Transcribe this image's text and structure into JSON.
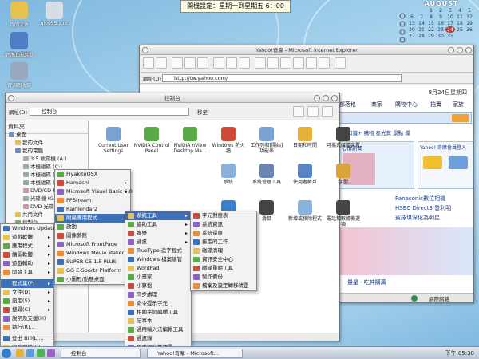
{
  "desktop": {
    "icons": [
      {
        "label": "我的文件",
        "color": "#e8c04f"
      },
      {
        "label": "ql0995.jr.rit",
        "color": "#d7dde7"
      },
      {
        "label": "我的電腦",
        "color": "#6d8fc3"
      },
      {
        "label": "網路上的芳鄰",
        "color": "#4f7cc4"
      },
      {
        "label": "資源回收筒",
        "color": "#9aa9bf"
      }
    ],
    "banner": "開機設定：星期一到星期五 6：00"
  },
  "calendar": {
    "month": "AUGUST",
    "weeks": [
      [
        "",
        "",
        "1",
        "2",
        "3",
        "4",
        "5"
      ],
      [
        "6",
        "7",
        "8",
        "9",
        "10",
        "11",
        "12"
      ],
      [
        "13",
        "14",
        "15",
        "16",
        "17",
        "18",
        "19"
      ],
      [
        "20",
        "21",
        "22",
        "23",
        "24",
        "25",
        "26"
      ],
      [
        "27",
        "28",
        "29",
        "30",
        "31",
        "",
        ""
      ]
    ],
    "today": "24"
  },
  "ie_window": {
    "title": "Yahoo!奇摩 - Microsoft Internet Explorer",
    "address_label": "網址(D)",
    "url": "http://tw.yahoo.com/",
    "date_text": "8月24日星期四",
    "nav_tabs": [
      "部落格",
      "商家",
      "購物中心",
      "拍賣",
      "家族"
    ],
    "links_row": "知識+  購物  星光賞  景點  欄",
    "member_text": "Yahoo! 奇摩會員登入",
    "heart_text": "心情新聞",
    "news": [
      "Panasonic數位相機",
      "HSBC Direct3 發利明",
      "賓詠琪深化為明星"
    ],
    "bottom_text": "量星 · 吃神購萬",
    "status": "網際網路"
  },
  "cp_window": {
    "title": "控制台",
    "address_label": "網址(D)",
    "address_value": "控制台",
    "go_label": "移至",
    "tree_header": "資料夾",
    "tree": [
      "桌面",
      "我的文件",
      "我的電腦",
      "3.5 軟碟機 (A:)",
      "本機磁碟 (C:)",
      "本機磁碟 (D:)",
      "本機磁碟 (E:)",
      "DVD/CD-RW",
      "光碟機 (G:)",
      "DVD 光碟機",
      "共用文件",
      "控制台"
    ],
    "icons": [
      "Current User Settings",
      "NVIDIA Control Panel",
      "NVIDIA nView Desktop Ma...",
      "Windows 防火牆",
      "工作列和[開始]功能表",
      "日期和時間",
      "可攜式媒體裝置",
      "系統",
      "系統管理工具",
      "使用者帳戶",
      "字型",
      "自動更新",
      "滑鼠",
      "新增或移除程式",
      "電話和數據機選項",
      "顯示"
    ]
  },
  "menus": {
    "start_menu": [
      "Windows Update",
      "遊戲軟體",
      "應用程式",
      "繪圖軟體",
      "遊戲輔助",
      "開發工具",
      "程式集(P)",
      "文件(D)",
      "設定(S)",
      "搜尋(C)",
      "說明及支援(H)",
      "執行(R)...",
      "登出 Bill(L)...",
      "電腦關機(U)..."
    ],
    "programs": [
      "FlyakiteOSX",
      "Hamachi",
      "Microsoft Visual Basic 6.0",
      "PPStream",
      "Rainlendar2",
      "附屬應用程式",
      "啟動",
      "圖像夢館",
      "Microsoft FrontPage",
      "Windows Movie Maker",
      "SUPER C5 1.5 PLUS",
      "GG E-Sports Platform",
      "小圖形/動態桌面"
    ],
    "accessories": [
      "系統工具",
      "協助工具",
      "娛樂",
      "通訊",
      "TrueType 造字程式",
      "Windows 檔案總管",
      "WordPad",
      "小畫家",
      "小算盤",
      "同步處理",
      "命令提示字元",
      "相關字詞編輯工具",
      "記事本",
      "通用輸入法編輯工具",
      "通訊錄",
      "程式相容性精靈",
      "導覽 Windows XP"
    ],
    "system_tools": [
      "字元對應表",
      "系統資訊",
      "系統還原",
      "排定的工作",
      "磁碟清理",
      "資訊安全中心",
      "磁碟重組工具",
      "製作備份",
      "檔案及設定轉移精靈"
    ]
  },
  "taskbar": {
    "start_label": "",
    "tasks": [
      "控制台",
      "Yahoo!奇摩 - Microsoft..."
    ],
    "clock": "下午 05:30"
  }
}
